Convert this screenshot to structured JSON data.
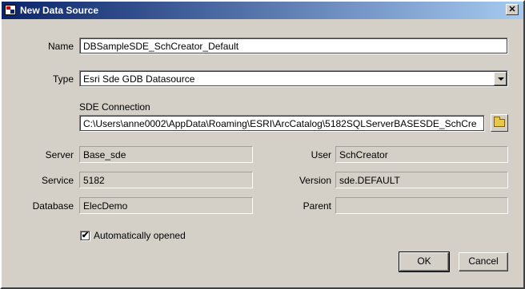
{
  "window": {
    "title": "New Data Source",
    "close_glyph": "✕"
  },
  "form": {
    "name_label": "Name",
    "name_value": "DBSampleSDE_SchCreator_Default",
    "type_label": "Type",
    "type_value": "Esri Sde GDB Datasource",
    "sde_label": "SDE Connection",
    "sde_value": "C:\\Users\\anne0002\\AppData\\Roaming\\ESRI\\ArcCatalog\\5182SQLServerBASESDE_SchCre",
    "server_label": "Server",
    "server_value": "Base_sde",
    "service_label": "Service",
    "service_value": "5182",
    "database_label": "Database",
    "database_value": "ElecDemo",
    "user_label": "User",
    "user_value": "SchCreator",
    "version_label": "Version",
    "version_value": "sde.DEFAULT",
    "parent_label": "Parent",
    "parent_value": "",
    "auto_open_label": "Automatically opened",
    "auto_open_checked": "✔"
  },
  "buttons": {
    "ok": "OK",
    "cancel": "Cancel"
  },
  "icons": {
    "app": "app-icon",
    "close": "close-icon",
    "dropdown": "chevron-down-icon",
    "browse": "folder-open-icon"
  }
}
